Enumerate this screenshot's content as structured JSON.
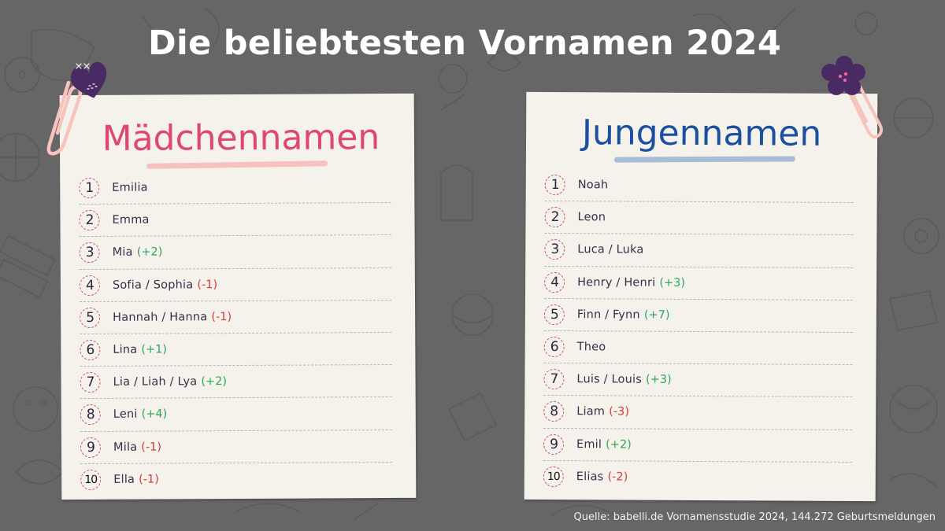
{
  "title": "Die beliebtesten Vornamen 2024",
  "colors": {
    "background": "#666666",
    "paper": "#f5f2ec",
    "girls_accent": "#e0476d",
    "boys_accent": "#1b4fa0",
    "increase": "#2ea85a",
    "decrease": "#d6403a",
    "text": "#3a2d4a"
  },
  "girls": {
    "heading": "Mädchennamen",
    "clip_icon": "heart-paperclip-icon",
    "items": [
      {
        "rank": "1",
        "name": "Emilia",
        "change": "",
        "trend": ""
      },
      {
        "rank": "2",
        "name": "Emma",
        "change": "",
        "trend": ""
      },
      {
        "rank": "3",
        "name": "Mia",
        "change": "(+2)",
        "trend": "up"
      },
      {
        "rank": "4",
        "name": "Sofia / Sophia",
        "change": "(-1)",
        "trend": "down"
      },
      {
        "rank": "5",
        "name": "Hannah / Hanna",
        "change": "(-1)",
        "trend": "down"
      },
      {
        "rank": "6",
        "name": "Lina",
        "change": "(+1)",
        "trend": "up"
      },
      {
        "rank": "7",
        "name": "Lia / Liah / Lya",
        "change": "(+2)",
        "trend": "up"
      },
      {
        "rank": "8",
        "name": "Leni",
        "change": "(+4)",
        "trend": "up"
      },
      {
        "rank": "9",
        "name": "Mila",
        "change": "(-1)",
        "trend": "down"
      },
      {
        "rank": "10",
        "name": "Ella",
        "change": "(-1)",
        "trend": "down"
      }
    ]
  },
  "boys": {
    "heading": "Jungennamen",
    "clip_icon": "flower-paperclip-icon",
    "items": [
      {
        "rank": "1",
        "name": "Noah",
        "change": "",
        "trend": ""
      },
      {
        "rank": "2",
        "name": "Leon",
        "change": "",
        "trend": ""
      },
      {
        "rank": "3",
        "name": "Luca / Luka",
        "change": "",
        "trend": ""
      },
      {
        "rank": "4",
        "name": "Henry / Henri",
        "change": "(+3)",
        "trend": "up"
      },
      {
        "rank": "5",
        "name": "Finn / Fynn",
        "change": "(+7)",
        "trend": "up"
      },
      {
        "rank": "6",
        "name": "Theo",
        "change": "",
        "trend": ""
      },
      {
        "rank": "7",
        "name": "Luis / Louis",
        "change": "(+3)",
        "trend": "up"
      },
      {
        "rank": "8",
        "name": "Liam",
        "change": "(-3)",
        "trend": "down"
      },
      {
        "rank": "9",
        "name": "Emil",
        "change": "(+2)",
        "trend": "up"
      },
      {
        "rank": "10",
        "name": "Elias",
        "change": "(-2)",
        "trend": "down"
      }
    ]
  },
  "source": "Quelle: babelli.de Vornamensstudie 2024, 144.272 Geburtsmeldungen"
}
